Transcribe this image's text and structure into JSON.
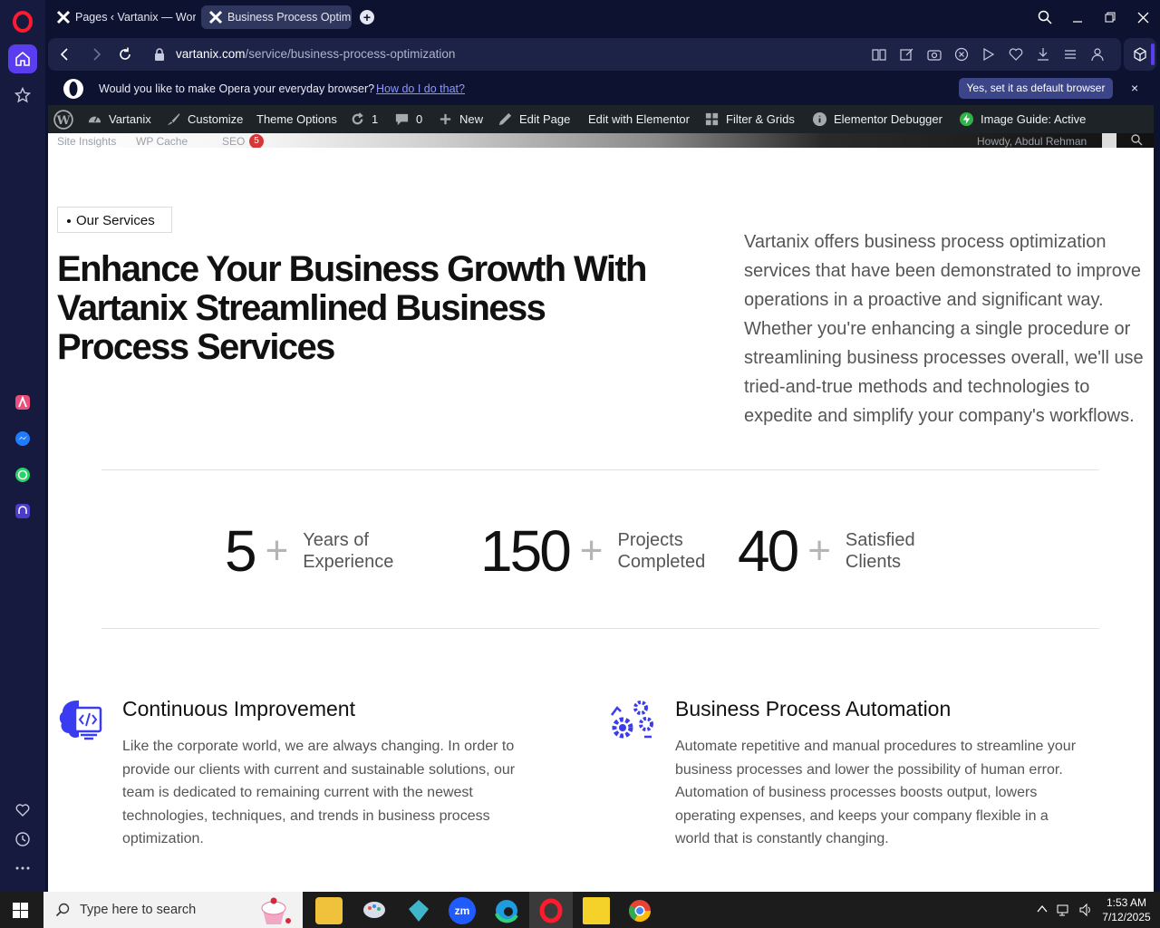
{
  "browser": {
    "tabs": [
      {
        "label": "Pages ‹ Vartanix — WordPress"
      },
      {
        "label": "Business Process Optimization"
      }
    ],
    "url_host": "vartanix.com",
    "url_path": "/service/business-process-optimization"
  },
  "banner": {
    "text": "Would you like to make Opera your everyday browser?",
    "link": "How do I do that?",
    "button": "Yes, set it as default browser",
    "close": "×"
  },
  "adminbar": {
    "site": "Vartanix",
    "customize": "Customize",
    "theme_options": "Theme Options",
    "updates": "1",
    "comments": "0",
    "new": "New",
    "edit_page": "Edit Page",
    "elementor": "Edit with Elementor",
    "filter": "Filter & Grids",
    "debugger": "Elementor Debugger",
    "image_guide": "Image Guide: Active",
    "sub_1": "Site Insights",
    "sub_2": "WP Cache",
    "sub_3": "SEO",
    "seo_count": "5",
    "howdy": "Howdy, Abdul Rehman"
  },
  "hero": {
    "tag": "Our Services",
    "title": "Enhance Your Business Growth With Vartanix Streamlined Business Process Services",
    "description": "Vartanix offers business process optimization services that have been demonstrated to improve operations in a proactive and significant way. Whether you're enhancing a single procedure or streamlining business processes overall, we'll use tried-and-true methods and technologies to expedite and simplify your company's workflows."
  },
  "stats": [
    {
      "number": "5",
      "plus": "+",
      "label": "Years of Experience"
    },
    {
      "number": "150",
      "plus": "+",
      "label": "Projects Completed"
    },
    {
      "number": "40",
      "plus": "+",
      "label": "Satisfied Clients"
    }
  ],
  "features": [
    {
      "title": "Continuous Improvement",
      "text": "Like the corporate world, we are always changing. In order to provide our clients with current and sustainable solutions, our team is dedicated to remaining current with the newest technologies, techniques, and trends in business process optimization."
    },
    {
      "title": "Business Process Automation",
      "text": "Automate repetitive and manual procedures to streamline your business processes and lower the possibility of human error. Automation of business processes boosts output, lowers operating expenses, and keeps your company flexible in a world that is constantly changing."
    }
  ],
  "taskbar": {
    "search_placeholder": "Type here to search",
    "time": "1:53 AM",
    "date": "7/12/2025"
  },
  "colors": {
    "accent": "#3a3cf0",
    "opera_red": "#ff1b2d",
    "admin_bg": "#1d2327"
  }
}
